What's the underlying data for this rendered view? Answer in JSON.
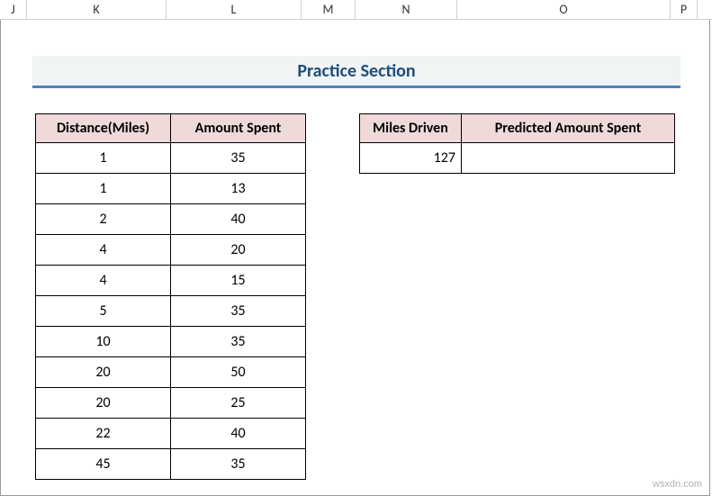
{
  "columns": {
    "J": "J",
    "K": "K",
    "L": "L",
    "M": "M",
    "N": "N",
    "O": "O",
    "P": "P"
  },
  "title": "Practice Section",
  "table1": {
    "headers": [
      "Distance(Miles)",
      "Amount Spent"
    ],
    "rows": [
      [
        "1",
        "35"
      ],
      [
        "1",
        "13"
      ],
      [
        "2",
        "40"
      ],
      [
        "4",
        "20"
      ],
      [
        "4",
        "15"
      ],
      [
        "5",
        "35"
      ],
      [
        "10",
        "35"
      ],
      [
        "20",
        "50"
      ],
      [
        "20",
        "25"
      ],
      [
        "22",
        "40"
      ],
      [
        "45",
        "35"
      ]
    ]
  },
  "table2": {
    "headers": [
      "Miles Driven",
      "Predicted Amount Spent"
    ],
    "rows": [
      [
        "127",
        ""
      ]
    ]
  },
  "watermark": "wsxdn.com"
}
